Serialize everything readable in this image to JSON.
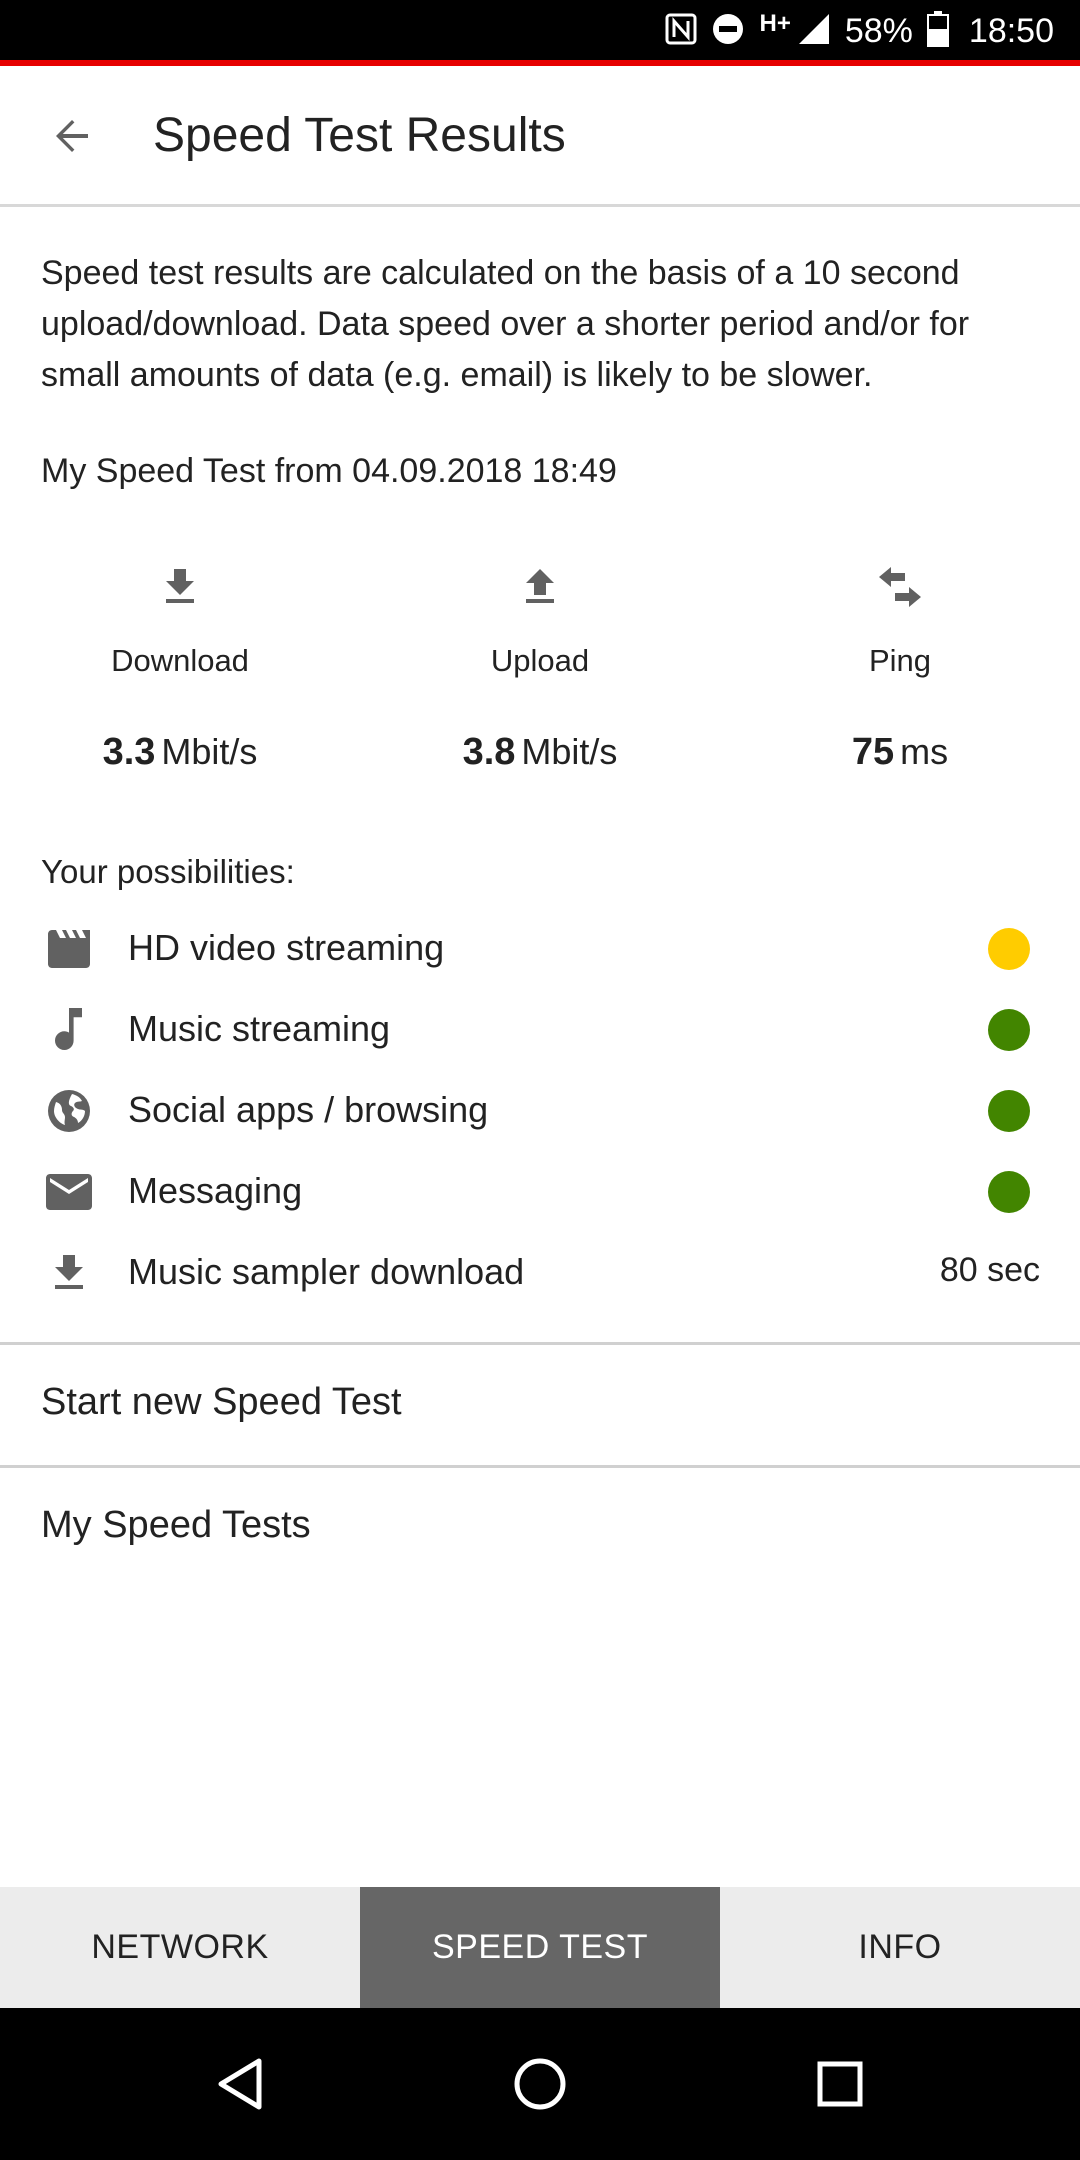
{
  "status_bar": {
    "network": "H+",
    "battery": "58%",
    "time": "18:50",
    "icons": [
      "nfc-icon",
      "do-not-disturb-icon",
      "signal-icon",
      "battery-icon"
    ]
  },
  "app_bar": {
    "title": "Speed Test Results",
    "back_icon": "arrow-back-icon"
  },
  "intro": "Speed test results are calculated on the basis of a 10 second upload/download. Data speed over a shorter period and/or for small amounts of data (e.g. email) is likely to be slower.",
  "test_date": "My Speed Test from 04.09.2018 18:49",
  "metrics": [
    {
      "label": "Download",
      "value": "3.3",
      "unit": "Mbit/s",
      "icon": "download-icon"
    },
    {
      "label": "Upload",
      "value": "3.8",
      "unit": "Mbit/s",
      "icon": "upload-icon"
    },
    {
      "label": "Ping",
      "value": "75",
      "unit": "ms",
      "icon": "ping-arrows-icon"
    }
  ],
  "possibilities": {
    "title": "Your possibilities:",
    "items": [
      {
        "label": "HD video streaming",
        "icon": "movie-icon",
        "status_color": "#ffcc00"
      },
      {
        "label": "Music streaming",
        "icon": "music-note-icon",
        "status_color": "#428500"
      },
      {
        "label": "Social apps / browsing",
        "icon": "globe-icon",
        "status_color": "#428500"
      },
      {
        "label": "Messaging",
        "icon": "mail-icon",
        "status_color": "#428500"
      },
      {
        "label": "Music sampler download",
        "icon": "download-icon",
        "value": "80 sec"
      }
    ]
  },
  "menu": {
    "start_new": "Start new Speed Test",
    "my_tests": "My Speed Tests"
  },
  "tabs": {
    "items": [
      {
        "label": "NETWORK"
      },
      {
        "label": "SPEED TEST"
      },
      {
        "label": "INFO"
      }
    ],
    "active": "SPEED TEST",
    "active_color": "#666666"
  },
  "nav_bar": {
    "icons": [
      "back-triangle-icon",
      "home-circle-icon",
      "recents-square-icon"
    ]
  },
  "colors": {
    "accent": "#e60000",
    "good": "#428500",
    "medium": "#ffcc00"
  }
}
